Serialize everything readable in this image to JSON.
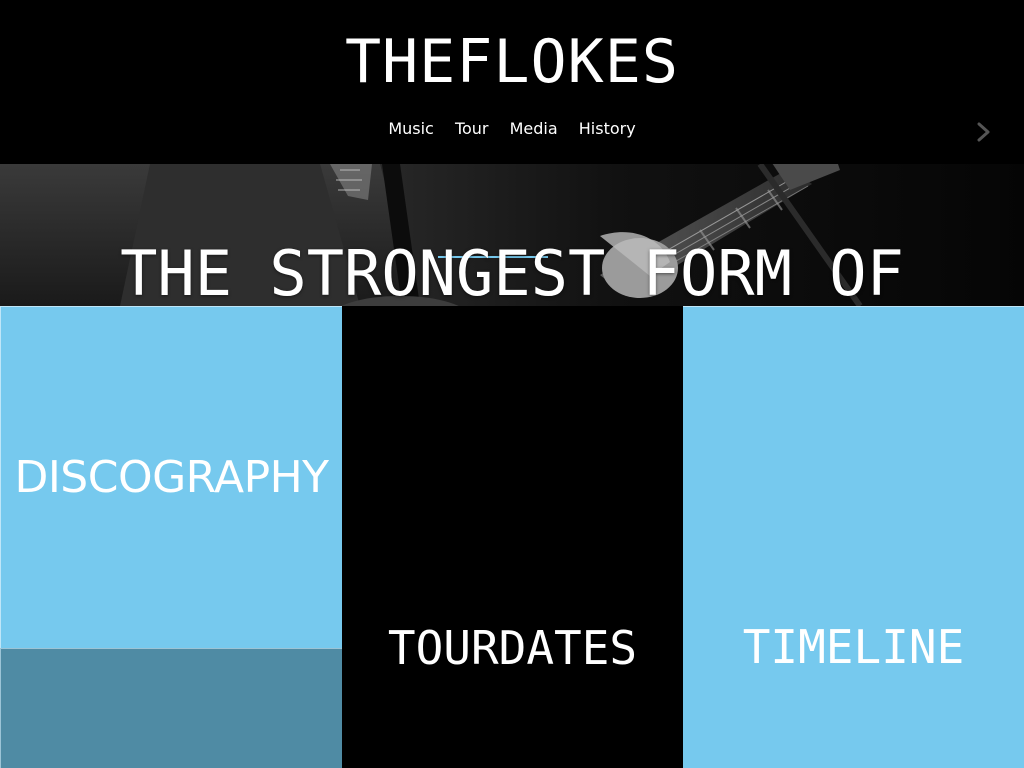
{
  "header": {
    "site_title": "THEFLOKES",
    "nav": [
      "Music",
      "Tour",
      "Media",
      "History"
    ]
  },
  "hero": {
    "tagline": "THE STRONGEST FORM OF",
    "next_icon": "chevron-right-icon"
  },
  "tiles": {
    "discography": "DISCOGRAPHY",
    "tourdates": "TOURDATES",
    "timeline": "TIMELINE"
  },
  "colors": {
    "accent_blue": "#76c9ee",
    "muted_blue": "#4f8ba4",
    "black": "#000000",
    "white": "#ffffff"
  }
}
